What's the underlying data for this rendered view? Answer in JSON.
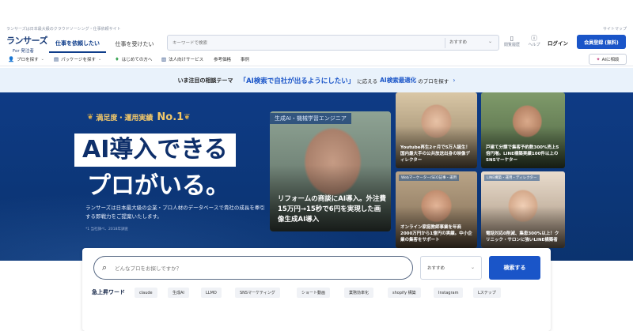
{
  "util": {
    "tagline": "ランサーズは日本最大級のクラウドソーシング・仕事依頼サイト",
    "site_link": "サイトマップ"
  },
  "header": {
    "logo_text": "ランサーズ",
    "logo_sub": "For 発注者",
    "tab_order": "仕事を依頼したい",
    "tab_receive": "仕事を受けたい",
    "search_placeholder": "キーワードで検索",
    "search_select": "おすすめ",
    "icon_history": "閲覧履歴",
    "icon_help": "ヘルプ",
    "login": "ログイン",
    "signup": "会員登録 (無料)"
  },
  "subnav": {
    "items": [
      {
        "label": "プロを探す",
        "icon": "person-icon",
        "dropdown": true
      },
      {
        "label": "パッケージを探す",
        "icon": "package-icon",
        "dropdown": true
      },
      {
        "label": "はじめての方へ",
        "icon": "beginner-icon",
        "dropdown": false
      },
      {
        "label": "法人向けサービス",
        "icon": "building-icon",
        "dropdown": false
      },
      {
        "label": "参考価格",
        "icon": "",
        "dropdown": false
      },
      {
        "label": "事例",
        "icon": "",
        "dropdown": false
      }
    ],
    "ai_consult": "AIに相談"
  },
  "promo": {
    "prefix": "いま注目の相談テーマ",
    "highlight": "「AI検索で自社が出るようにしたい」",
    "middle": "に応える",
    "highlight2": "AI検索最適化",
    "suffix": "のプロを探す"
  },
  "hero": {
    "badge_text": "満足度・運用実績",
    "badge_rank": "No.1",
    "headline_1": "AI導入できる",
    "headline_2": "プロがいる。",
    "description": "ランサーズは日本最大級の企業・プロ人材のデータベースで貴社の成長を牽引する即戦力をご提案いたします。",
    "note": "*1 当社調べ、2018年調査",
    "main_card": {
      "tag": "生成AI・機械学習エンジニア",
      "caption": "リフォームの商談にAI導入。外注費15万円→15秒で6円を実現した画像生成AI導入"
    },
    "cards": [
      {
        "tag": "",
        "caption": "Youtube再生2ヶ月で5万人誕生！国内最大手の公共放送出身の映像ディレクター"
      },
      {
        "tag": "",
        "caption": "戸建て分譲で集客予約数300%売上5倍円増。LINE構築実績100件以上のSNSマーケター"
      },
      {
        "tag": "Webマーケーター/SEO記事・運用",
        "caption": "オンライン家庭教師事業を年商2000万円から1億円の実績。中小企業の集客をサポート"
      },
      {
        "tag": "LINE構築・運用・ディレクター",
        "caption": "電話対応0削減、集患300%以上！クリニック・サロンに強いLINE構築者"
      }
    ]
  },
  "search_panel": {
    "placeholder": "どんなプロをお探しですか？",
    "select": "おすすめ",
    "button": "検索する",
    "trending_label": "急上昇ワード",
    "keywords": [
      "claude",
      "生成AI",
      "LLMO",
      "SNSマーケティング",
      "ショート動画",
      "業務効率化",
      "shopify 構築",
      "Instagram",
      "Lステップ"
    ]
  }
}
